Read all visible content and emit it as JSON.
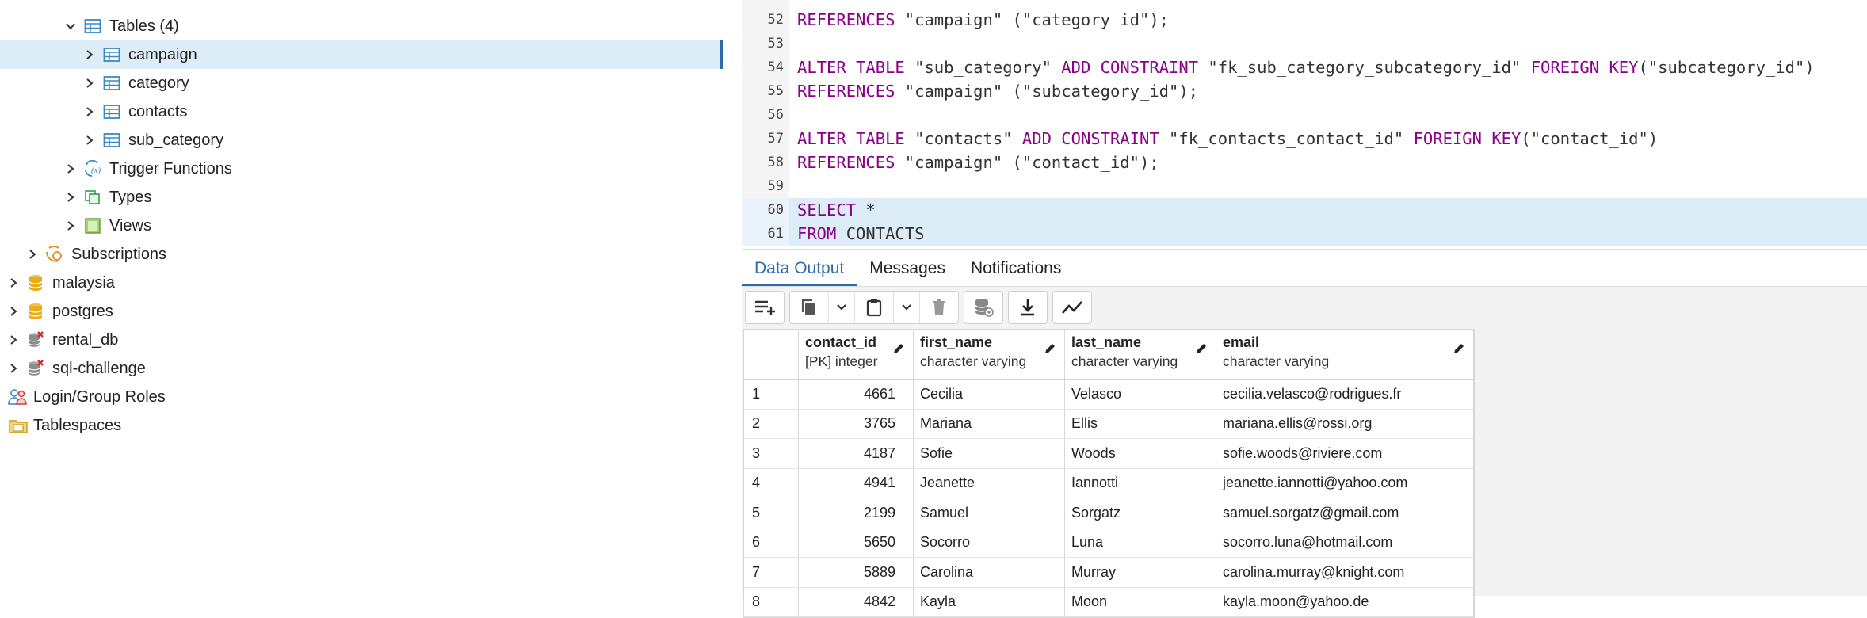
{
  "tree": {
    "items": [
      {
        "label": "Tables (4)",
        "icon": "tables-icon",
        "expanded": true,
        "level": 3
      },
      {
        "label": "campaign",
        "icon": "table-icon",
        "selected": true,
        "level": 4
      },
      {
        "label": "category",
        "icon": "table-icon",
        "level": 4
      },
      {
        "label": "contacts",
        "icon": "table-icon",
        "level": 4
      },
      {
        "label": "sub_category",
        "icon": "table-icon",
        "level": 4
      },
      {
        "label": "Trigger Functions",
        "icon": "trigger-functions-icon",
        "level": 3
      },
      {
        "label": "Types",
        "icon": "types-icon",
        "level": 3
      },
      {
        "label": "Views",
        "icon": "views-icon",
        "level": 3
      },
      {
        "label": "Subscriptions",
        "icon": "subscriptions-icon",
        "level": 1
      },
      {
        "label": "malaysia",
        "icon": "database-icon",
        "level": 0
      },
      {
        "label": "postgres",
        "icon": "database-icon",
        "level": 0
      },
      {
        "label": "rental_db",
        "icon": "database-disconnected-icon",
        "level": 0
      },
      {
        "label": "sql-challenge",
        "icon": "database-disconnected-icon",
        "level": 0
      },
      {
        "label": "Login/Group Roles",
        "icon": "login-roles-icon",
        "level": -1
      },
      {
        "label": "Tablespaces",
        "icon": "tablespaces-icon",
        "level": -1
      }
    ]
  },
  "editor": {
    "lines": [
      {
        "num": "52",
        "text": "REFERENCES \"campaign\" (\"category_id\");"
      },
      {
        "num": "53",
        "text": ""
      },
      {
        "num": "54",
        "text": "ALTER TABLE \"sub_category\" ADD CONSTRAINT \"fk_sub_category_subcategory_id\" FOREIGN KEY(\"subcategory_id\")"
      },
      {
        "num": "55",
        "text": "REFERENCES \"campaign\" (\"subcategory_id\");"
      },
      {
        "num": "56",
        "text": ""
      },
      {
        "num": "57",
        "text": "ALTER TABLE \"contacts\" ADD CONSTRAINT \"fk_contacts_contact_id\" FOREIGN KEY(\"contact_id\")"
      },
      {
        "num": "58",
        "text": "REFERENCES \"campaign\" (\"contact_id\");"
      },
      {
        "num": "59",
        "text": ""
      },
      {
        "num": "60",
        "text": "SELECT *"
      },
      {
        "num": "61",
        "text": "FROM CONTACTS"
      }
    ]
  },
  "output": {
    "tabs": [
      "Data Output",
      "Messages",
      "Notifications"
    ],
    "columns": [
      {
        "name": "contact_id",
        "type": "[PK] integer"
      },
      {
        "name": "first_name",
        "type": "character varying"
      },
      {
        "name": "last_name",
        "type": "character varying"
      },
      {
        "name": "email",
        "type": "character varying"
      }
    ],
    "rows": [
      [
        "1",
        "4661",
        "Cecilia",
        "Velasco",
        "cecilia.velasco@rodrigues.fr"
      ],
      [
        "2",
        "3765",
        "Mariana",
        "Ellis",
        "mariana.ellis@rossi.org"
      ],
      [
        "3",
        "4187",
        "Sofie",
        "Woods",
        "sofie.woods@riviere.com"
      ],
      [
        "4",
        "4941",
        "Jeanette",
        "Iannotti",
        "jeanette.iannotti@yahoo.com"
      ],
      [
        "5",
        "2199",
        "Samuel",
        "Sorgatz",
        "samuel.sorgatz@gmail.com"
      ],
      [
        "6",
        "5650",
        "Socorro",
        "Luna",
        "socorro.luna@hotmail.com"
      ],
      [
        "7",
        "5889",
        "Carolina",
        "Murray",
        "carolina.murray@knight.com"
      ],
      [
        "8",
        "4842",
        "Kayla",
        "Moon",
        "kayla.moon@yahoo.de"
      ]
    ]
  },
  "colors": {
    "accent": "#2f6ba5",
    "selection": "#dcedf8",
    "keyword": "#8b008b"
  }
}
